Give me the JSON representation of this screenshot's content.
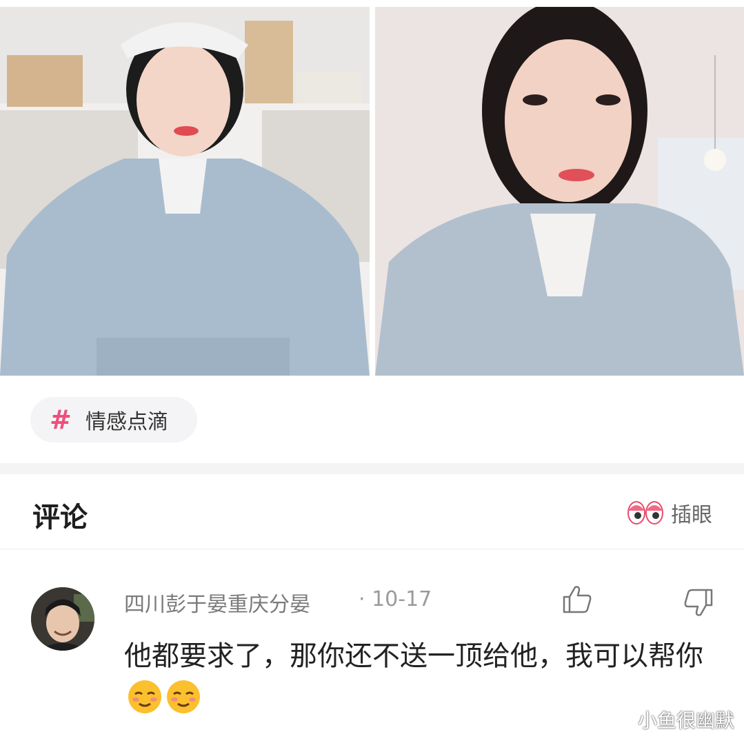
{
  "post": {
    "tag": {
      "hash": "#",
      "label": "情感点滴"
    }
  },
  "comments_section": {
    "title": "评论",
    "peek_label": "插眼"
  },
  "comments": [
    {
      "user": "四川彭于晏重庆分晏",
      "date": "· 10-17",
      "text": "他都要求了，那你还不送一顶给他，我可以帮你"
    }
  ],
  "watermark": "小鱼很幽默",
  "colors": {
    "tag_hash": "#ef4f7d",
    "separator": "#f4f4f4"
  },
  "icons": [
    "hash-icon",
    "peek-eyes-icon",
    "thumbs-up-icon",
    "thumbs-down-icon",
    "smirk-emoji"
  ]
}
